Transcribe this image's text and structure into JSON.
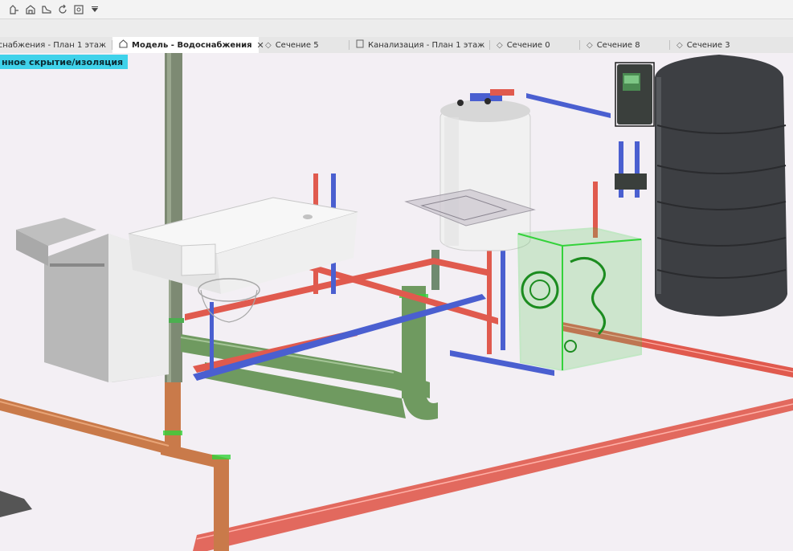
{
  "toolbar": {
    "icons": [
      "fence-icon",
      "building-icon",
      "shoe-icon",
      "refresh-icon",
      "window-icon",
      "dropdown-arrow-icon"
    ]
  },
  "tabs": [
    {
      "label": "оснабжения - План 1 этаж",
      "icon": "none",
      "active": false,
      "closable": false
    },
    {
      "label": "Модель - Водоснабжения",
      "icon": "home-icon",
      "active": true,
      "closable": true
    },
    {
      "label": "Сечение 5",
      "icon": "section-icon",
      "active": false,
      "closable": false
    },
    {
      "label": "Канализация - План 1 этаж",
      "icon": "plan-icon",
      "active": false,
      "closable": false
    },
    {
      "label": "Сечение 0",
      "icon": "section-icon",
      "active": false,
      "closable": false
    },
    {
      "label": "Сечение 8",
      "icon": "section-icon",
      "active": false,
      "closable": false
    },
    {
      "label": "Сечение 3",
      "icon": "section-icon",
      "active": false,
      "closable": false
    }
  ],
  "view": {
    "mode_label": "нное скрытие/изоляция",
    "mode_color": "#3fd2ea",
    "colors": {
      "hot_water": "#e05a4e",
      "cold_water": "#4a5fd0",
      "sewer": "#6f9a60",
      "drain": "#c97a4a",
      "selection": "#33d23a",
      "tank": "#3d3f43",
      "background": "#f3eff4"
    }
  }
}
